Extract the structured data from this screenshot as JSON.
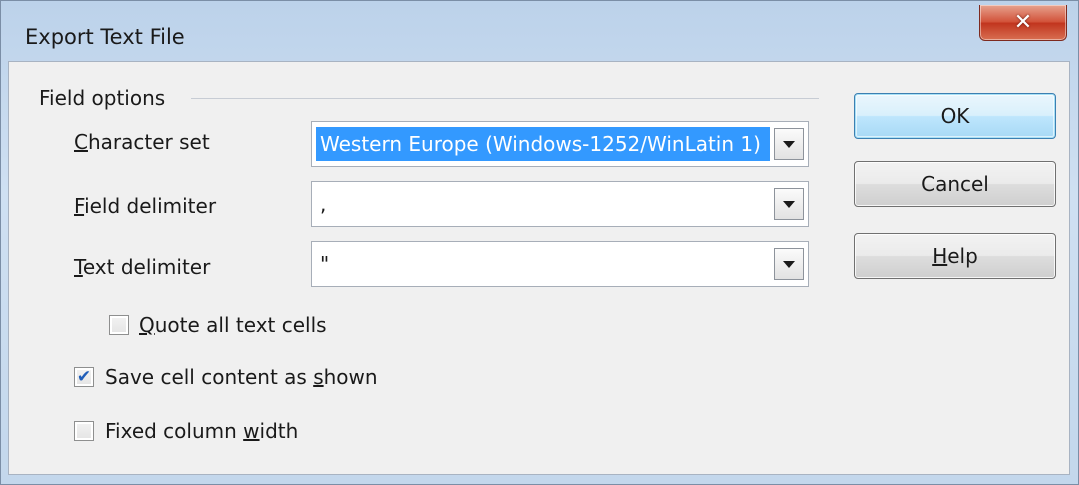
{
  "window": {
    "title": "Export Text File",
    "close_glyph": "✕"
  },
  "group": {
    "label": "Field options"
  },
  "character_set": {
    "mnemonic": "C",
    "label_rest": "haracter set",
    "value": "Western Europe (Windows-1252/WinLatin 1)",
    "selected": true
  },
  "field_delimiter": {
    "mnemonic": "F",
    "label_rest": "ield delimiter",
    "value": ","
  },
  "text_delimiter": {
    "mnemonic": "T",
    "label_rest": "ext delimiter",
    "value": "\""
  },
  "quote_all": {
    "mnemonic": "Q",
    "label_rest": "uote all text cells",
    "checked": false
  },
  "save_as_shown": {
    "label_pre": "Save cell content as ",
    "mnemonic": "s",
    "label_post": "hown",
    "checked": true
  },
  "fixed_width": {
    "label_pre": "Fixed column ",
    "mnemonic": "w",
    "label_post": "idth",
    "checked": false
  },
  "buttons": {
    "ok": "OK",
    "cancel": "Cancel",
    "help_mnemonic": "H",
    "help_rest": "elp"
  },
  "check_glyph": "✔",
  "colors": {
    "selection": "#3399ff",
    "check": "#1f5db8",
    "close_red": "#c1351e",
    "default_button_border": "#3c7fb1"
  },
  "icons": {
    "close": "close-icon",
    "dropdown": "chevron-down-icon",
    "check": "checkmark-icon"
  }
}
